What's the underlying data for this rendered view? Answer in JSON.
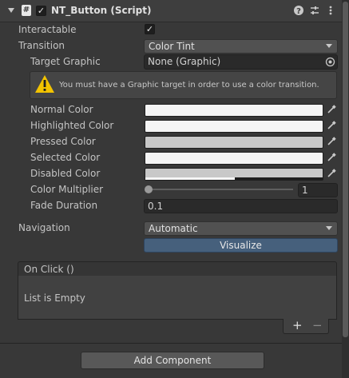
{
  "component": {
    "title": "NT_Button (Script)",
    "enabled": true,
    "script_icon": "#",
    "icons": [
      "help-icon",
      "preset-icon",
      "more-icon"
    ]
  },
  "fields": {
    "interactable": {
      "label": "Interactable",
      "checked": true
    },
    "transition": {
      "label": "Transition",
      "value": "Color Tint"
    },
    "target_graphic": {
      "label": "Target Graphic",
      "value": "None (Graphic)"
    },
    "warning": {
      "text": "You must have a Graphic target in order to use a color transition."
    },
    "normal_color": {
      "label": "Normal Color",
      "color": "#f5f5f5"
    },
    "highlighted_color": {
      "label": "Highlighted Color",
      "color": "#f5f5f5"
    },
    "pressed_color": {
      "label": "Pressed Color",
      "color": "#c8c8c8"
    },
    "selected_color": {
      "label": "Selected Color",
      "color": "#f5f5f5"
    },
    "disabled_color": {
      "label": "Disabled Color",
      "color": "#c8c8c8"
    },
    "color_multiplier": {
      "label": "Color Multiplier",
      "value": "1",
      "slider_fraction": 0.0
    },
    "fade_duration": {
      "label": "Fade Duration",
      "value": "0.1"
    },
    "navigation": {
      "label": "Navigation",
      "value": "Automatic"
    },
    "visualize": {
      "label": "Visualize"
    }
  },
  "on_click": {
    "header": "On Click ()",
    "empty_text": "List is Empty",
    "add_label": "+",
    "remove_label": "−"
  },
  "footer": {
    "add_component": "Add Component"
  }
}
